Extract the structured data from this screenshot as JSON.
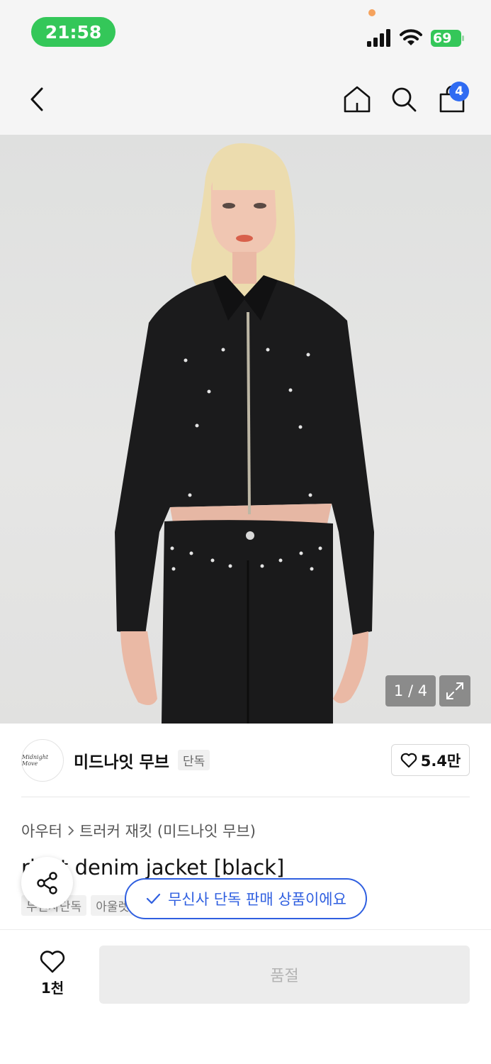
{
  "status_bar": {
    "time": "21:58",
    "battery": "69"
  },
  "nav": {
    "cart_count": "4"
  },
  "image": {
    "counter": "1 / 4",
    "current": 1,
    "total": 4
  },
  "brand": {
    "logo_text": "Midnight Move",
    "name": "미드나잇 무브",
    "exclusive_tag": "단독",
    "like_count": "5.4만"
  },
  "breadcrumb": {
    "category": "아우터",
    "subcategory": "트러커 재킷 (미드나잇 무브)"
  },
  "product": {
    "title": "rivet denim jacket [black]",
    "tags": [
      "무신사단독",
      "아울렛"
    ]
  },
  "toast": {
    "message": "무신사 단독 판매 상품이에요"
  },
  "bottom": {
    "wish_count": "1천",
    "soldout_label": "품절"
  },
  "colors": {
    "status_green": "#34c759",
    "badge_blue": "#2f6bf2",
    "toast_blue": "#2f5fe0"
  },
  "icons": [
    "back-icon",
    "home-icon",
    "search-icon",
    "bag-icon",
    "expand-icon",
    "heart-icon",
    "share-icon",
    "check-icon"
  ]
}
